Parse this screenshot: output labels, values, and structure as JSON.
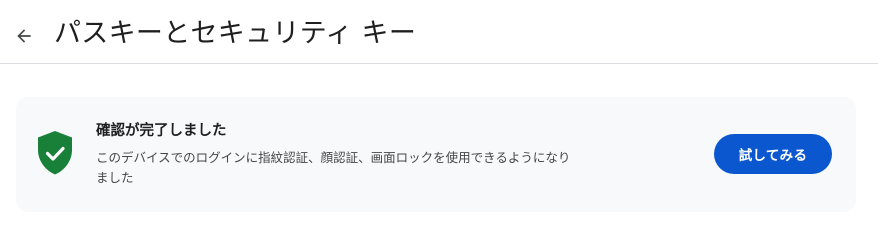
{
  "header": {
    "back_icon": "arrow-left-icon",
    "title": "パスキーとセキュリティ キー"
  },
  "status_card": {
    "icon": "shield-check-icon",
    "icon_color": "#188038",
    "title": "確認が完了しました",
    "description": "このデバイスでのログインに指紋認証、顔認証、画面ロックを使用できるようになりました",
    "button_label": "試してみる",
    "button_color": "#0b57d0"
  }
}
